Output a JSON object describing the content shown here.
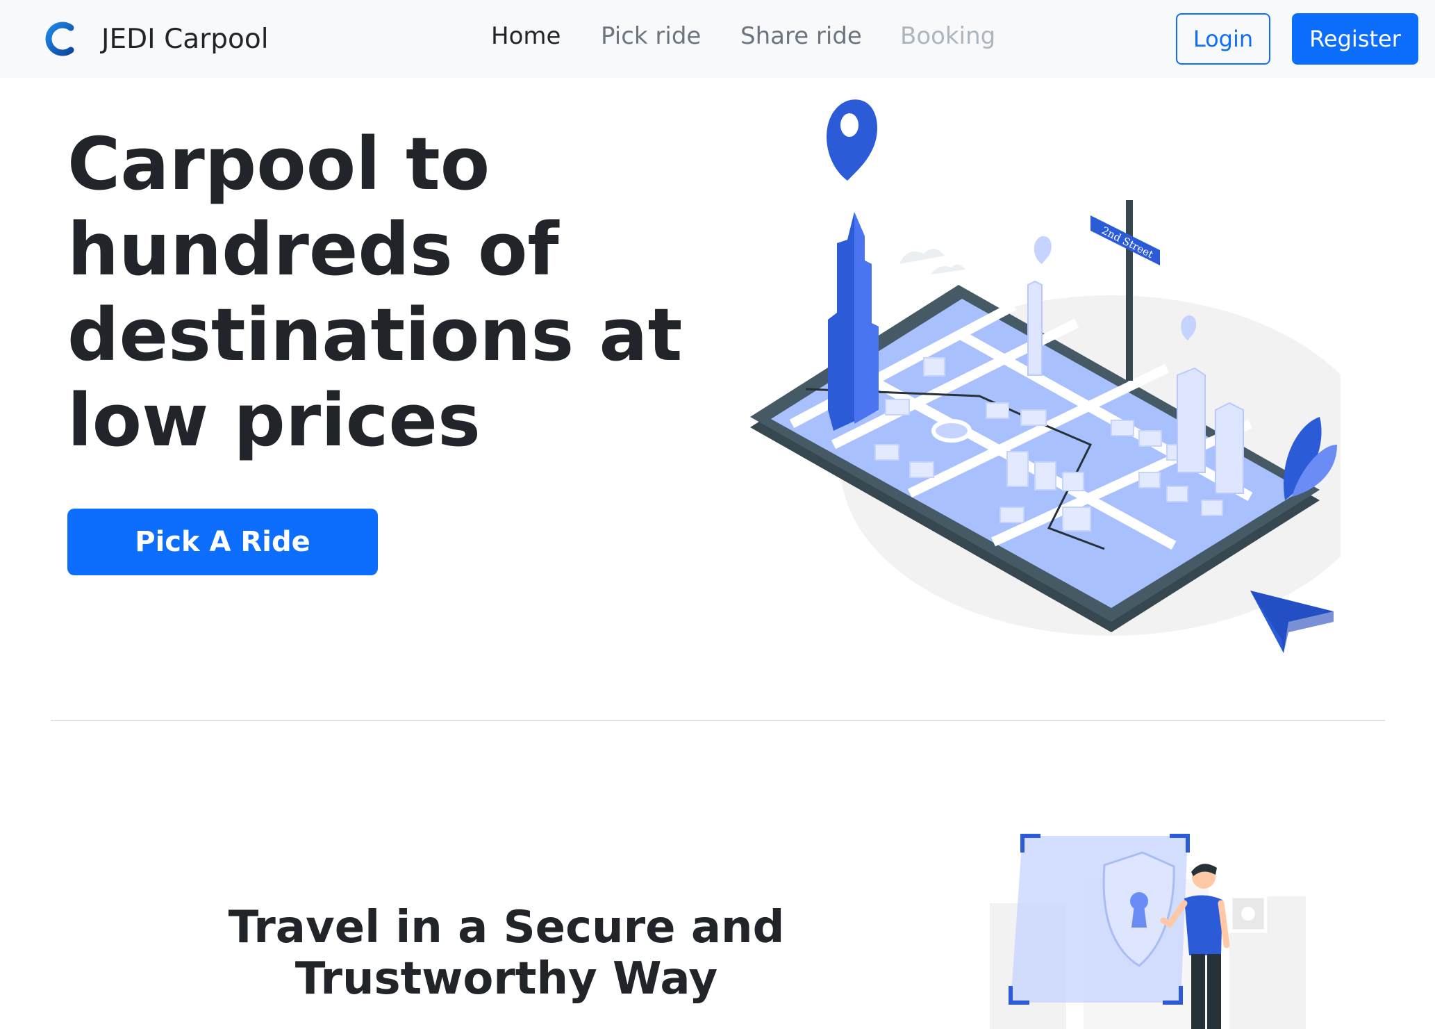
{
  "navbar": {
    "brand": {
      "text": "JEDI Carpool",
      "logo_icon": "c-logo-icon"
    },
    "links": [
      {
        "label": "Home",
        "state": "active"
      },
      {
        "label": "Pick ride",
        "state": "normal"
      },
      {
        "label": "Share ride",
        "state": "normal"
      },
      {
        "label": "Booking",
        "state": "disabled"
      }
    ],
    "login_label": "Login",
    "register_label": "Register"
  },
  "hero": {
    "title": "Carpool to hundreds of destinations at low prices",
    "cta_label": "Pick A Ride",
    "illustration_sign_text": "2nd Street"
  },
  "secure_section": {
    "title": "Travel in a Secure and Trustworthy Way"
  },
  "colors": {
    "primary": "#0d6efd",
    "navbar_bg": "#f8f9fa",
    "text_dark": "#212529",
    "illustration_blue": "#4169e1",
    "illustration_light_blue": "#c5d3ff"
  }
}
